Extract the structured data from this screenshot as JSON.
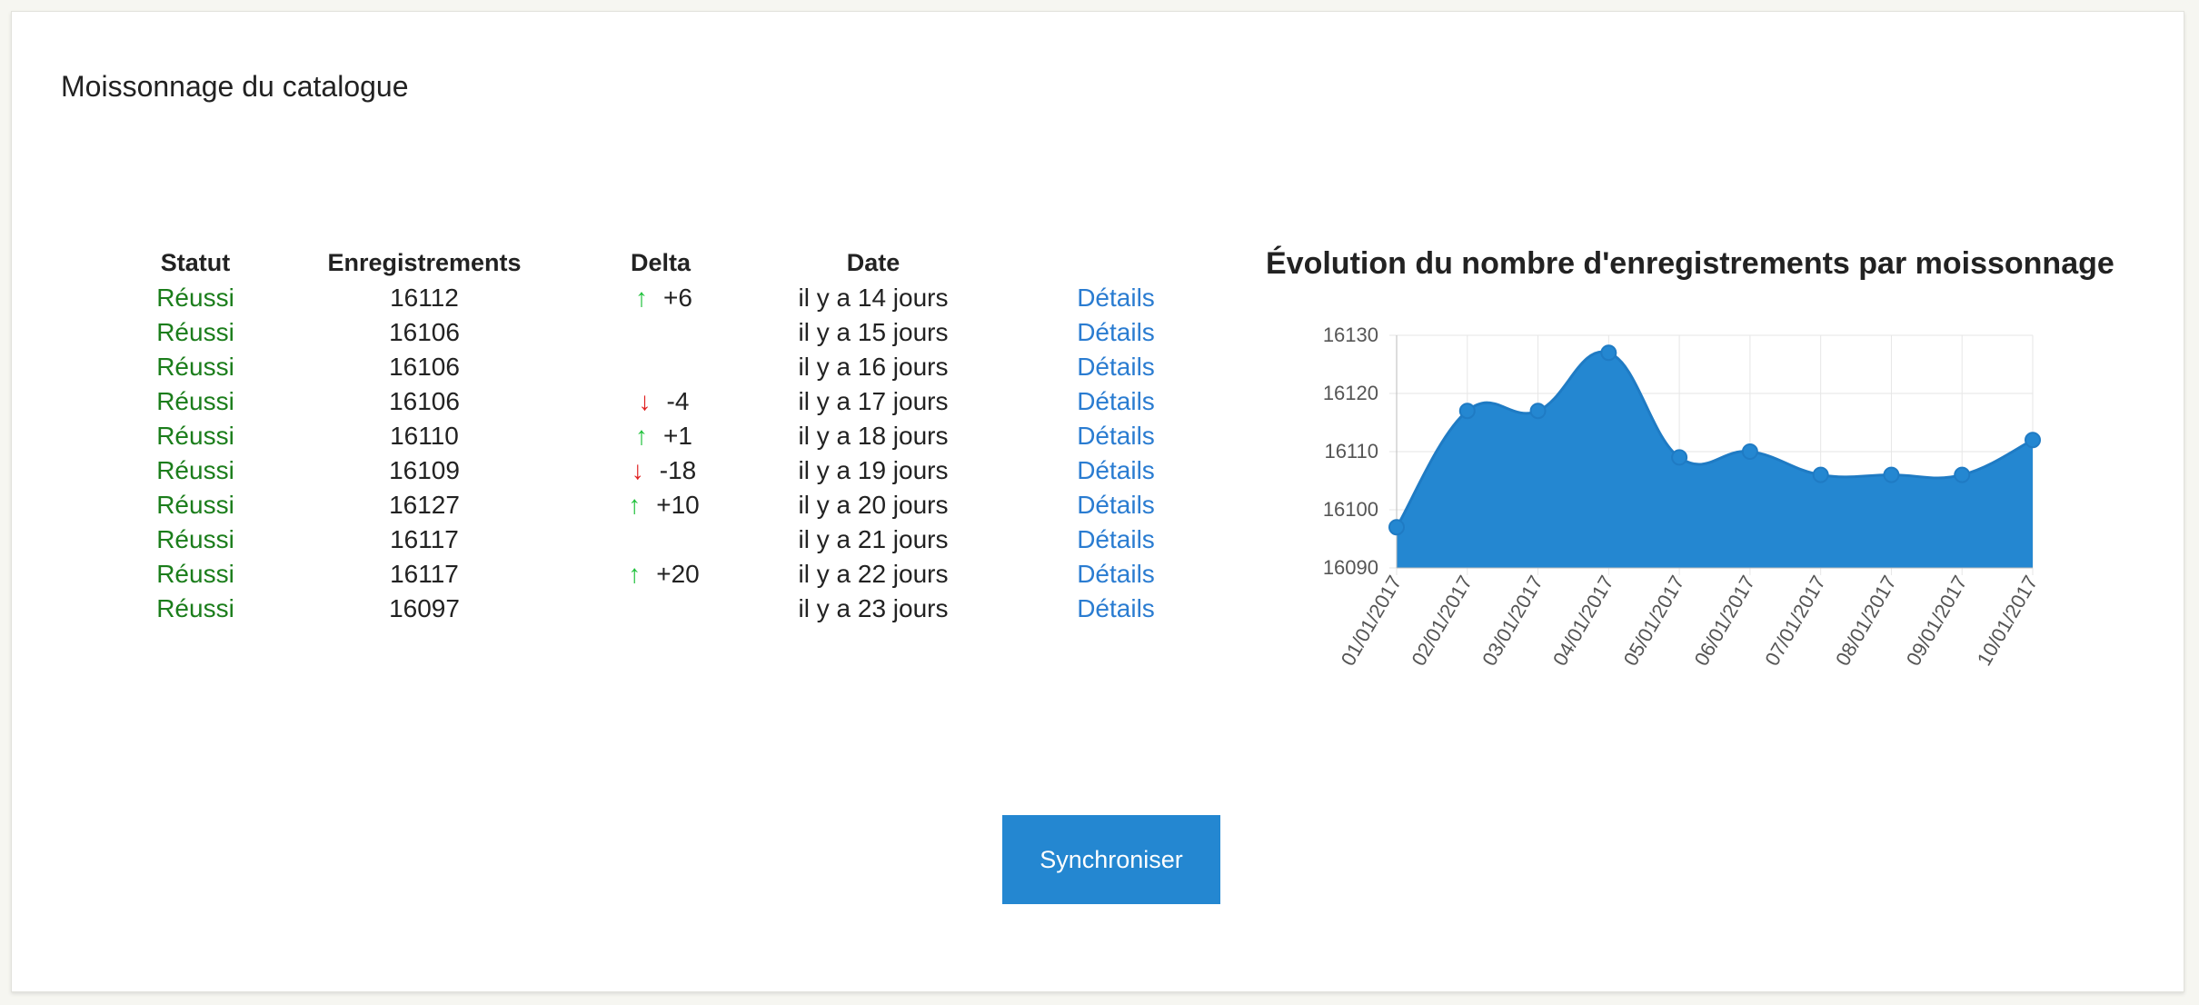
{
  "page": {
    "title": "Moissonnage du catalogue"
  },
  "table": {
    "headers": {
      "status": "Statut",
      "count": "Enregistrements",
      "delta": "Delta",
      "date": "Date"
    },
    "rows": [
      {
        "status": "Réussi",
        "count": "16112",
        "delta": "+6",
        "direction": "up",
        "date": "il y a 14 jours",
        "link": "Détails"
      },
      {
        "status": "Réussi",
        "count": "16106",
        "delta": "",
        "direction": "none",
        "date": "il y a 15 jours",
        "link": "Détails"
      },
      {
        "status": "Réussi",
        "count": "16106",
        "delta": "",
        "direction": "none",
        "date": "il y a 16 jours",
        "link": "Détails"
      },
      {
        "status": "Réussi",
        "count": "16106",
        "delta": "-4",
        "direction": "down",
        "date": "il y a 17 jours",
        "link": "Détails"
      },
      {
        "status": "Réussi",
        "count": "16110",
        "delta": "+1",
        "direction": "up",
        "date": "il y a 18 jours",
        "link": "Détails"
      },
      {
        "status": "Réussi",
        "count": "16109",
        "delta": "-18",
        "direction": "down",
        "date": "il y a 19 jours",
        "link": "Détails"
      },
      {
        "status": "Réussi",
        "count": "16127",
        "delta": "+10",
        "direction": "up",
        "date": "il y a 20 jours",
        "link": "Détails"
      },
      {
        "status": "Réussi",
        "count": "16117",
        "delta": "",
        "direction": "none",
        "date": "il y a 21 jours",
        "link": "Détails"
      },
      {
        "status": "Réussi",
        "count": "16117",
        "delta": "+20",
        "direction": "up",
        "date": "il y a 22 jours",
        "link": "Détails"
      },
      {
        "status": "Réussi",
        "count": "16097",
        "delta": "",
        "direction": "none",
        "date": "il y a 23 jours",
        "link": "Détails"
      }
    ]
  },
  "icons": {
    "up": "arrow-up-icon",
    "down": "arrow-down-icon"
  },
  "colors": {
    "status": "#1b7d1b",
    "link": "#2a7cd1",
    "arrow_up": "#1ec13a",
    "arrow_down": "#e02020",
    "chart_fill": "#2487d1",
    "button": "#2487d1"
  },
  "chart_data": {
    "type": "area",
    "title": "Évolution du nombre d'enregistrements par moissonnage",
    "x": [
      "01/01/2017",
      "02/01/2017",
      "03/01/2017",
      "04/01/2017",
      "05/01/2017",
      "06/01/2017",
      "07/01/2017",
      "08/01/2017",
      "09/01/2017",
      "10/01/2017"
    ],
    "series": [
      {
        "values": [
          16097,
          16117,
          16117,
          16127,
          16109,
          16110,
          16106,
          16106,
          16106,
          16112
        ]
      }
    ],
    "ylim": [
      16090,
      16130
    ],
    "yticks": [
      16130,
      16120,
      16110,
      16100,
      16090
    ],
    "grid": true,
    "legend": "none"
  },
  "actions": {
    "sync_label": "Synchroniser"
  }
}
